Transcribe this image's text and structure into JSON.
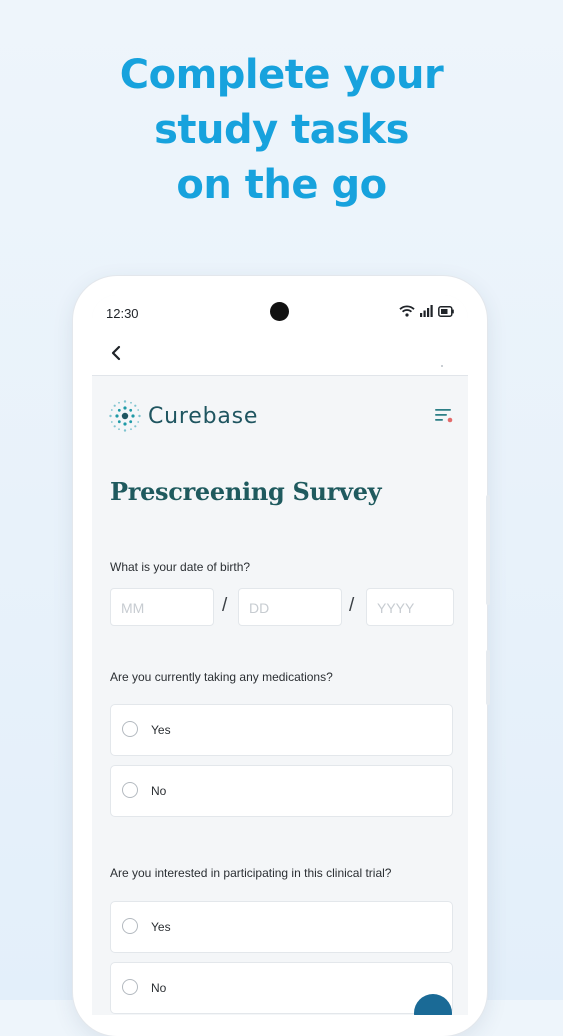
{
  "headline": {
    "line1": "Complete your",
    "line2": "study tasks",
    "line3": "on the go"
  },
  "status_bar": {
    "time": "12:30",
    "icons": [
      "wifi-icon",
      "signal-icon",
      "battery-icon"
    ]
  },
  "app_bar": {
    "back_icon": "chevron-left-icon"
  },
  "brand": {
    "name": "Curebase",
    "color": "#1f5560"
  },
  "survey": {
    "title": "Prescreening Survey",
    "dob": {
      "question": "What is your date of birth?",
      "month_placeholder": "MM",
      "day_placeholder": "DD",
      "year_placeholder": "YYYY",
      "separator": "/"
    },
    "medications": {
      "question": "Are you currently taking any medications?",
      "options": [
        "Yes",
        "No"
      ]
    },
    "interest": {
      "question": "Are you interested in participating in this clinical trial?",
      "options": [
        "Yes",
        "No"
      ]
    }
  },
  "colors": {
    "accent": "#17a2dd",
    "title": "#1f5a5e",
    "fab": "#1a6a96"
  }
}
